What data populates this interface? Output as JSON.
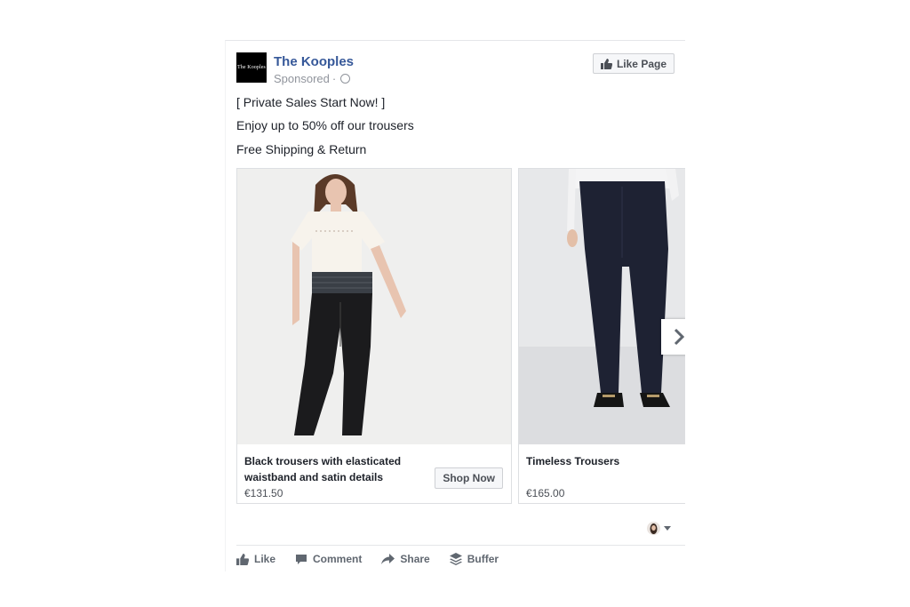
{
  "post": {
    "page_name": "The Kooples",
    "logo_text": "The Kooples",
    "sponsored": "Sponsored",
    "meta_dot": "·",
    "like_page_label": "Like Page",
    "lines": [
      "[ Private Sales Start Now! ]",
      "Enjoy up to 50% off our trousers",
      "Free Shipping & Return"
    ]
  },
  "carousel": {
    "cards": [
      {
        "title": "Black trousers with elasticated waistband and satin details",
        "price": "€131.50",
        "button": "Shop Now"
      },
      {
        "title": "Timeless Trousers",
        "price": "€165.00"
      }
    ]
  },
  "actions": {
    "like": "Like",
    "comment": "Comment",
    "share": "Share",
    "buffer": "Buffer"
  },
  "icons": {
    "thumbs_up": "thumbs-up-icon",
    "globe": "globe-icon",
    "comment": "comment-icon",
    "share": "share-icon",
    "buffer": "buffer-icon",
    "next": "chevron-right-icon"
  },
  "colors": {
    "brand_link": "#365899",
    "text": "#1d2129",
    "muted": "#90949c",
    "action": "#606770"
  }
}
